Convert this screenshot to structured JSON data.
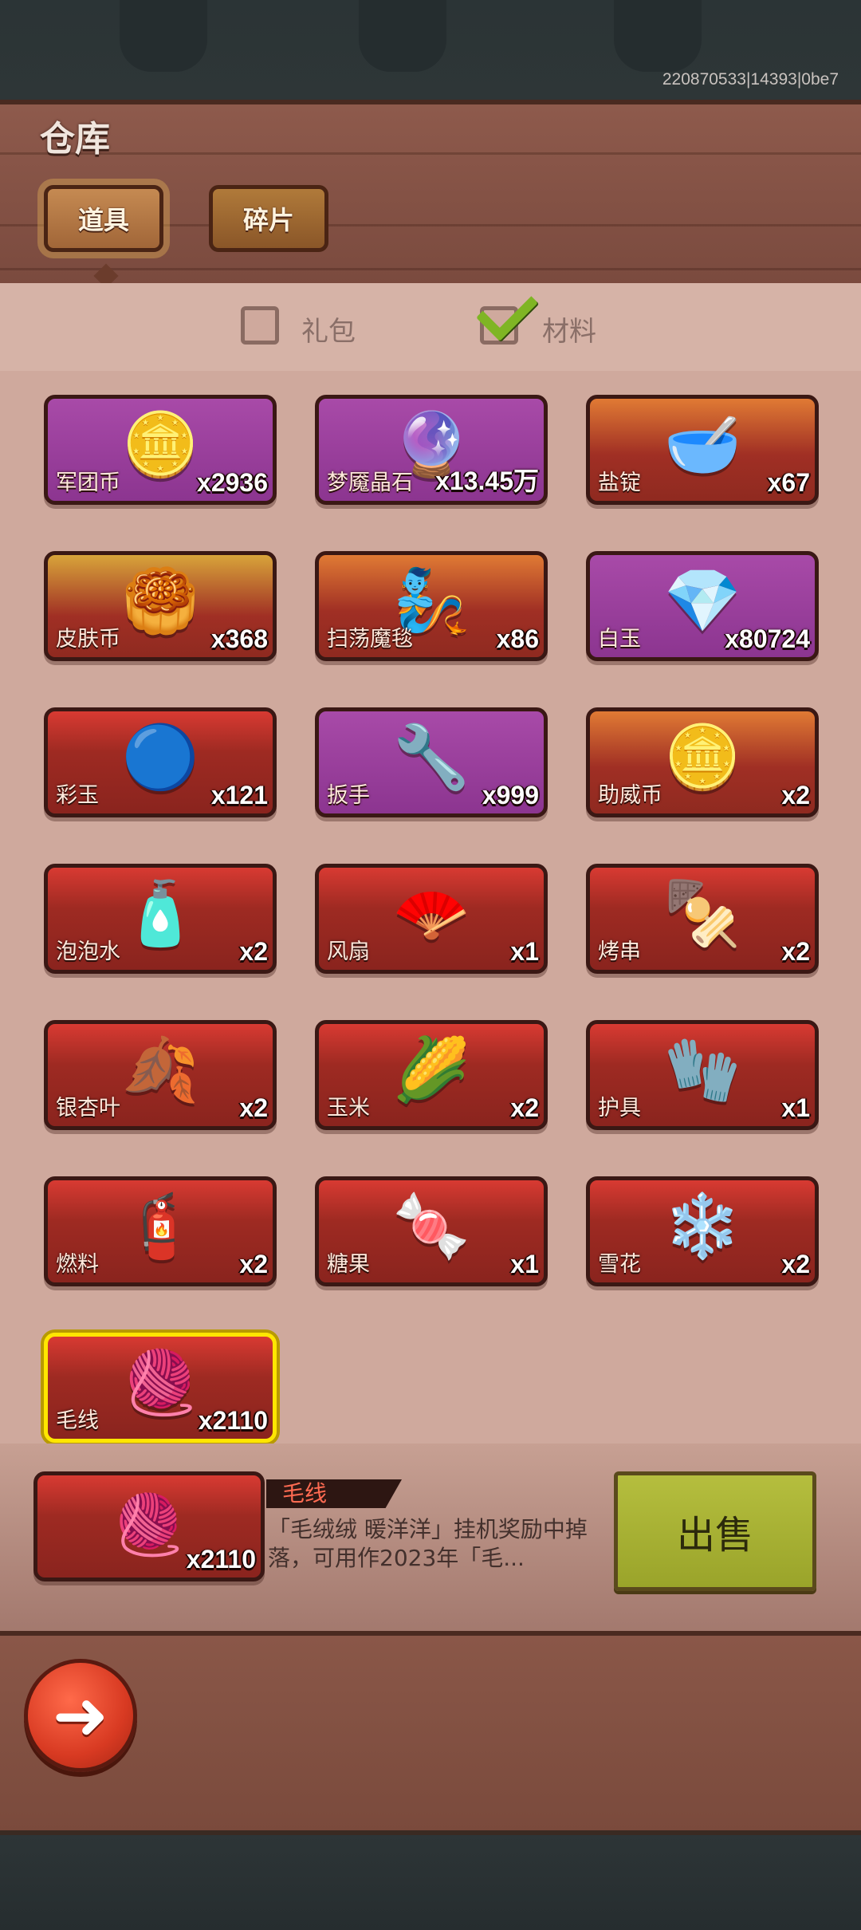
{
  "build_info": "220870533|14393|0be7",
  "header": {
    "title": "仓库"
  },
  "tabs": [
    {
      "label": "道具",
      "active": true
    },
    {
      "label": "碎片",
      "active": false
    }
  ],
  "filters": [
    {
      "label": "礼包",
      "checked": false
    },
    {
      "label": "材料",
      "checked": true
    }
  ],
  "items": [
    {
      "name": "军团币",
      "count": "x2936",
      "rarity": "purple",
      "icon": "🪙"
    },
    {
      "name": "梦魇晶石",
      "count": "x13.45万",
      "rarity": "purple",
      "icon": "🔮"
    },
    {
      "name": "盐锭",
      "count": "x67",
      "rarity": "orange",
      "icon": "🥣"
    },
    {
      "name": "皮肤币",
      "count": "x368",
      "rarity": "gold",
      "icon": "🥮"
    },
    {
      "name": "扫荡魔毯",
      "count": "x86",
      "rarity": "orange",
      "icon": "🧞"
    },
    {
      "name": "白玉",
      "count": "x80724",
      "rarity": "purple",
      "icon": "💎"
    },
    {
      "name": "彩玉",
      "count": "x121",
      "rarity": "red",
      "icon": "🔵"
    },
    {
      "name": "扳手",
      "count": "x999",
      "rarity": "purple",
      "icon": "🔧"
    },
    {
      "name": "助威币",
      "count": "x2",
      "rarity": "orange",
      "icon": "🪙"
    },
    {
      "name": "泡泡水",
      "count": "x2",
      "rarity": "red",
      "icon": "🧴"
    },
    {
      "name": "风扇",
      "count": "x1",
      "rarity": "red",
      "icon": "🪭"
    },
    {
      "name": "烤串",
      "count": "x2",
      "rarity": "red",
      "icon": "🍢"
    },
    {
      "name": "银杏叶",
      "count": "x2",
      "rarity": "red",
      "icon": "🍂"
    },
    {
      "name": "玉米",
      "count": "x2",
      "rarity": "red",
      "icon": "🌽"
    },
    {
      "name": "护具",
      "count": "x1",
      "rarity": "red",
      "icon": "🧤"
    },
    {
      "name": "燃料",
      "count": "x2",
      "rarity": "red",
      "icon": "🧯"
    },
    {
      "name": "糖果",
      "count": "x1",
      "rarity": "red",
      "icon": "🍬"
    },
    {
      "name": "雪花",
      "count": "x2",
      "rarity": "red",
      "icon": "❄️"
    },
    {
      "name": "毛线",
      "count": "x2110",
      "rarity": "red",
      "icon": "🧶",
      "selected": true
    }
  ],
  "detail": {
    "name": "毛线",
    "count": "x2110",
    "icon": "🧶",
    "description": "「毛绒绒 暖洋洋」挂机奖励中掉落，可用作2023年「毛..."
  },
  "sell_button": "出售",
  "back_icon": "back-arrow-icon"
}
